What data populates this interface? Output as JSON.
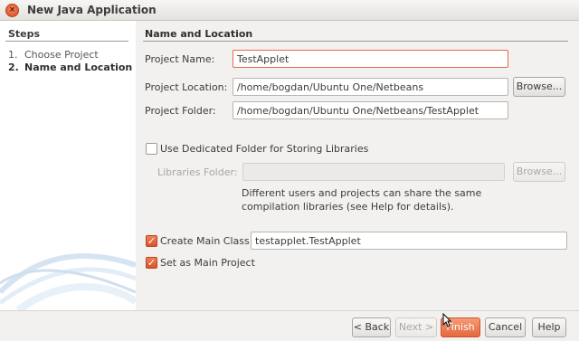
{
  "window": {
    "title": "New Java Application",
    "close_glyph": "×"
  },
  "steps": {
    "heading": "Steps",
    "items": [
      {
        "num": "1.",
        "label": "Choose Project"
      },
      {
        "num": "2.",
        "label": "Name and Location"
      }
    ]
  },
  "main": {
    "heading": "Name and Location",
    "project_name": {
      "label": "Project Name:",
      "value": "TestApplet"
    },
    "project_location": {
      "label": "Project Location:",
      "value": "/home/bogdan/Ubuntu One/Netbeans",
      "browse": "Browse..."
    },
    "project_folder": {
      "label": "Project Folder:",
      "value": "/home/bogdan/Ubuntu One/Netbeans/TestApplet"
    },
    "dedicated_folder": {
      "label": "Use Dedicated Folder for Storing Libraries",
      "checked": false
    },
    "libraries_folder": {
      "label": "Libraries Folder:",
      "value": "",
      "browse": "Browse..."
    },
    "info_text": "Different users and projects can share the same compilation libraries (see Help for details).",
    "create_main_class": {
      "label": "Create Main Class",
      "checked": true,
      "value": "testapplet.TestApplet",
      "check_glyph": "✓"
    },
    "set_main_project": {
      "label": "Set as Main Project",
      "checked": true,
      "check_glyph": "✓"
    }
  },
  "buttons": {
    "back": "< Back",
    "next": "Next >",
    "finish": "Finish",
    "cancel": "Cancel",
    "help": "Help"
  },
  "colors": {
    "accent": "#e4683f",
    "focus_border": "#e5694a"
  },
  "icons": {
    "close": "close-icon",
    "check": "checkmark-icon"
  }
}
